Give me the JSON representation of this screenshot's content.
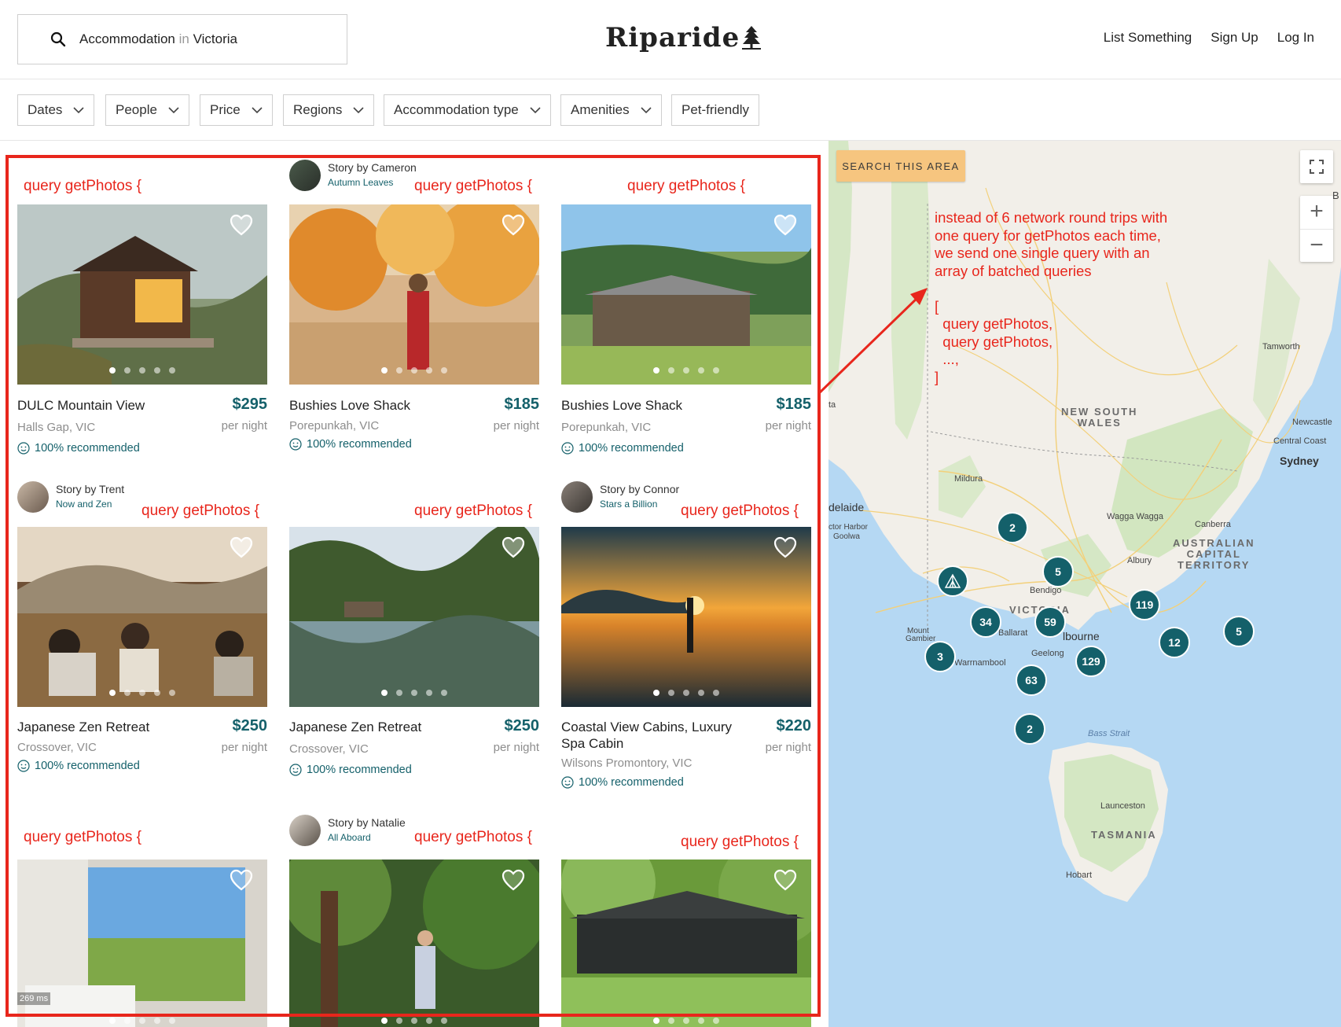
{
  "header": {
    "search_category": "Accommodation",
    "search_in": "in",
    "search_place": "Victoria",
    "logo": "Riparide",
    "links": [
      "List Something",
      "Sign Up",
      "Log In"
    ]
  },
  "filters": [
    "Dates",
    "People",
    "Price",
    "Regions",
    "Accommodation type",
    "Amenities",
    "Pet-friendly"
  ],
  "query_label": "query getPhotos {",
  "listings": [
    {
      "name": "DULC Mountain View",
      "price": "$295",
      "per": "per night",
      "location": "Halls Gap, VIC",
      "rec": "100% recommended"
    },
    {
      "name": "Bushies Love Shack",
      "price": "$185",
      "per": "per night",
      "location": "Porepunkah, VIC",
      "rec": "100% recommended",
      "story_by": "Story by Cameron",
      "story_title": "Autumn Leaves"
    },
    {
      "name": "Bushies Love Shack",
      "price": "$185",
      "per": "per night",
      "location": "Porepunkah, VIC",
      "rec": "100% recommended"
    },
    {
      "name": "Japanese Zen Retreat",
      "price": "$250",
      "per": "per night",
      "location": "Crossover, VIC",
      "rec": "100% recommended",
      "story_by": "Story by Trent",
      "story_title": "Now and Zen"
    },
    {
      "name": "Japanese Zen Retreat",
      "price": "$250",
      "per": "per night",
      "location": "Crossover, VIC",
      "rec": "100% recommended"
    },
    {
      "name": "Coastal View Cabins, Luxury Spa Cabin",
      "price": "$220",
      "per": "per night",
      "location": "Wilsons Promontory, VIC",
      "rec": "100% recommended",
      "story_by": "Story by Connor",
      "story_title": "Stars a Billion"
    },
    {
      "story_by": "Story by Natalie",
      "story_title": "All Aboard"
    }
  ],
  "timing_badge": "269 ms",
  "map": {
    "search_area": "SEARCH THIS AREA",
    "zoom_in": "+",
    "zoom_out": "−",
    "clusters": [
      "2",
      "5",
      "34",
      "59",
      "119",
      "12",
      "5",
      "3",
      "63",
      "129",
      "2"
    ],
    "places": [
      "Tamworth",
      "Newcastle",
      "Central Coast",
      "Sydney",
      "Mildura",
      "delaide",
      "ctor Harbor",
      "Goolwa",
      "Wagga Wagga",
      "Canberra",
      "Albury",
      "Bendigo",
      "Ballarat",
      "lbourne",
      "Geelong",
      "Warrnambool",
      "Mount",
      "Gambier",
      "Bass Strait",
      "Launceston",
      "Hobart",
      "ta",
      "B"
    ],
    "regions": {
      "nsw": "NEW SOUTH\nWALES",
      "act": "AUSTRALIAN\nCAPITAL\nTERRITORY",
      "vic": "VICTORIA",
      "tas": "TASMANIA"
    }
  },
  "annotation": "instead of 6 network round trips with\none query for getPhotos each time,\nwe send one single query with an\narray of batched queries\n\n[\n  query getPhotos,\n  query getPhotos,\n  ...,\n]"
}
